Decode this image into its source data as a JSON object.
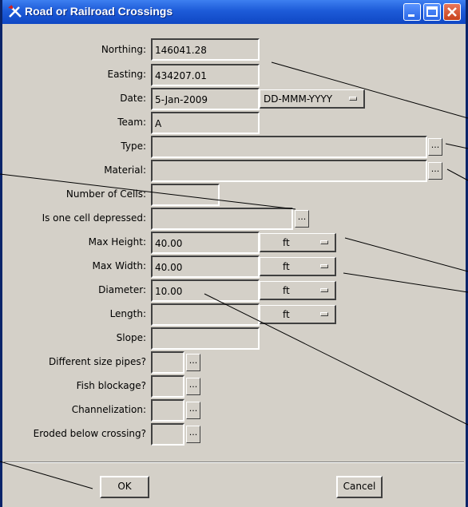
{
  "window": {
    "title": "Road or Railroad Crossings",
    "icon": "crossing-app-icon",
    "controls": [
      "minimize-icon",
      "maximize-icon",
      "close-icon"
    ]
  },
  "form": {
    "northing": {
      "label": "Northing:",
      "value": "146041.28"
    },
    "easting": {
      "label": "Easting:",
      "value": "434207.01"
    },
    "date": {
      "label": "Date:",
      "value": "5-Jan-2009",
      "format": "DD-MMM-YYYY"
    },
    "team": {
      "label": "Team:",
      "value": "A"
    },
    "type": {
      "label": "Type:",
      "value": "",
      "button": "..."
    },
    "material": {
      "label": "Material:",
      "value": "",
      "button": "..."
    },
    "number_of_cells": {
      "label": "Number of Cells:",
      "value": ""
    },
    "cell_depressed": {
      "label": "Is one cell depressed:",
      "value": "",
      "button": "..."
    },
    "max_height": {
      "label": "Max Height:",
      "value": "40.00",
      "unit": "ft"
    },
    "max_width": {
      "label": "Max Width:",
      "value": "40.00",
      "unit": "ft"
    },
    "diameter": {
      "label": "Diameter:",
      "value": "10.00",
      "unit": "ft"
    },
    "length": {
      "label": "Length:",
      "value": "",
      "unit": "ft"
    },
    "slope": {
      "label": "Slope:",
      "value": ""
    },
    "different_size_pipes": {
      "label": "Different size pipes?",
      "value": "",
      "button": "..."
    },
    "fish_blockage": {
      "label": "Fish blockage?",
      "value": "",
      "button": "..."
    },
    "channelization": {
      "label": "Channelization:",
      "value": "",
      "button": "..."
    },
    "eroded_below": {
      "label": "Eroded below crossing?",
      "value": "",
      "button": "..."
    }
  },
  "buttons": {
    "ok": "OK",
    "cancel": "Cancel"
  },
  "colors": {
    "titlebar": "#1d5bd8",
    "dialog": "#d4d0c8",
    "frame": "#0a246a"
  }
}
